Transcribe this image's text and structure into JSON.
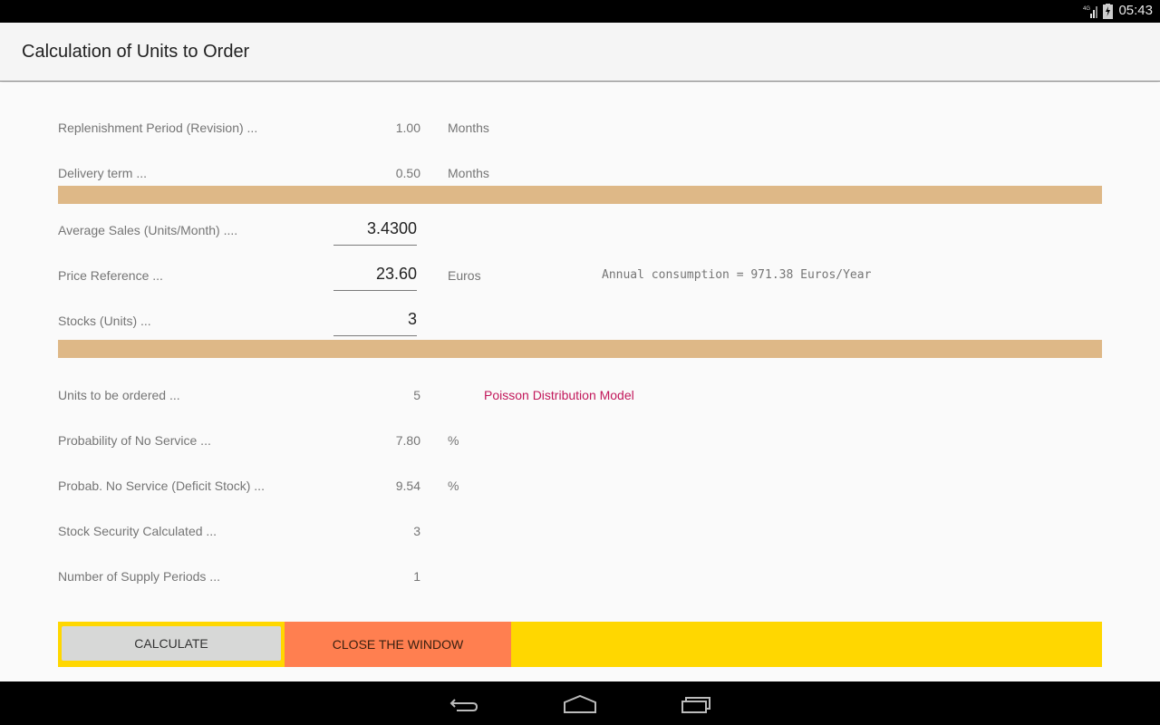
{
  "status_bar": {
    "network": "4G",
    "time": "05:43"
  },
  "action_bar": {
    "title": "Calculation of Units to Order"
  },
  "parameters": [
    {
      "label": "Replenishment Period (Revision) ...",
      "value": "1.00",
      "unit": "Months"
    },
    {
      "label": "Delivery term ...",
      "value": "0.50",
      "unit": "Months"
    }
  ],
  "inputs": {
    "average_sales": {
      "label": "Average Sales (Units/Month) ....",
      "value": "3.4300"
    },
    "price_reference": {
      "label": "Price Reference ...",
      "value": "23.60",
      "unit": "Euros"
    },
    "stocks": {
      "label": "Stocks (Units) ...",
      "value": "3"
    }
  },
  "annual_consumption": "Annual consumption = 971.38 Euros/Year",
  "results": [
    {
      "label": "Units to be ordered ...",
      "value": "5",
      "unit": ""
    },
    {
      "label": "Probability of No Service ...",
      "value": "7.80",
      "unit": "%"
    },
    {
      "label": "Probab. No Service (Deficit Stock) ...",
      "value": "9.54",
      "unit": "%"
    },
    {
      "label": "Stock Security Calculated ...",
      "value": "3",
      "unit": ""
    },
    {
      "label": "Number of Supply Periods ...",
      "value": "1",
      "unit": ""
    }
  ],
  "model_label": "Poisson Distribution Model",
  "buttons": {
    "calculate": "CALCULATE",
    "close": "CLOSE THE WINDOW"
  },
  "colors": {
    "divider": "#deb887",
    "button_bar": "#ffd700",
    "close_button": "#ff7f50",
    "calculate_button": "#d7d8d7",
    "model_label": "#c2185b"
  },
  "nav_bar": {
    "icons": [
      "back-icon",
      "home-icon",
      "recents-icon"
    ]
  }
}
